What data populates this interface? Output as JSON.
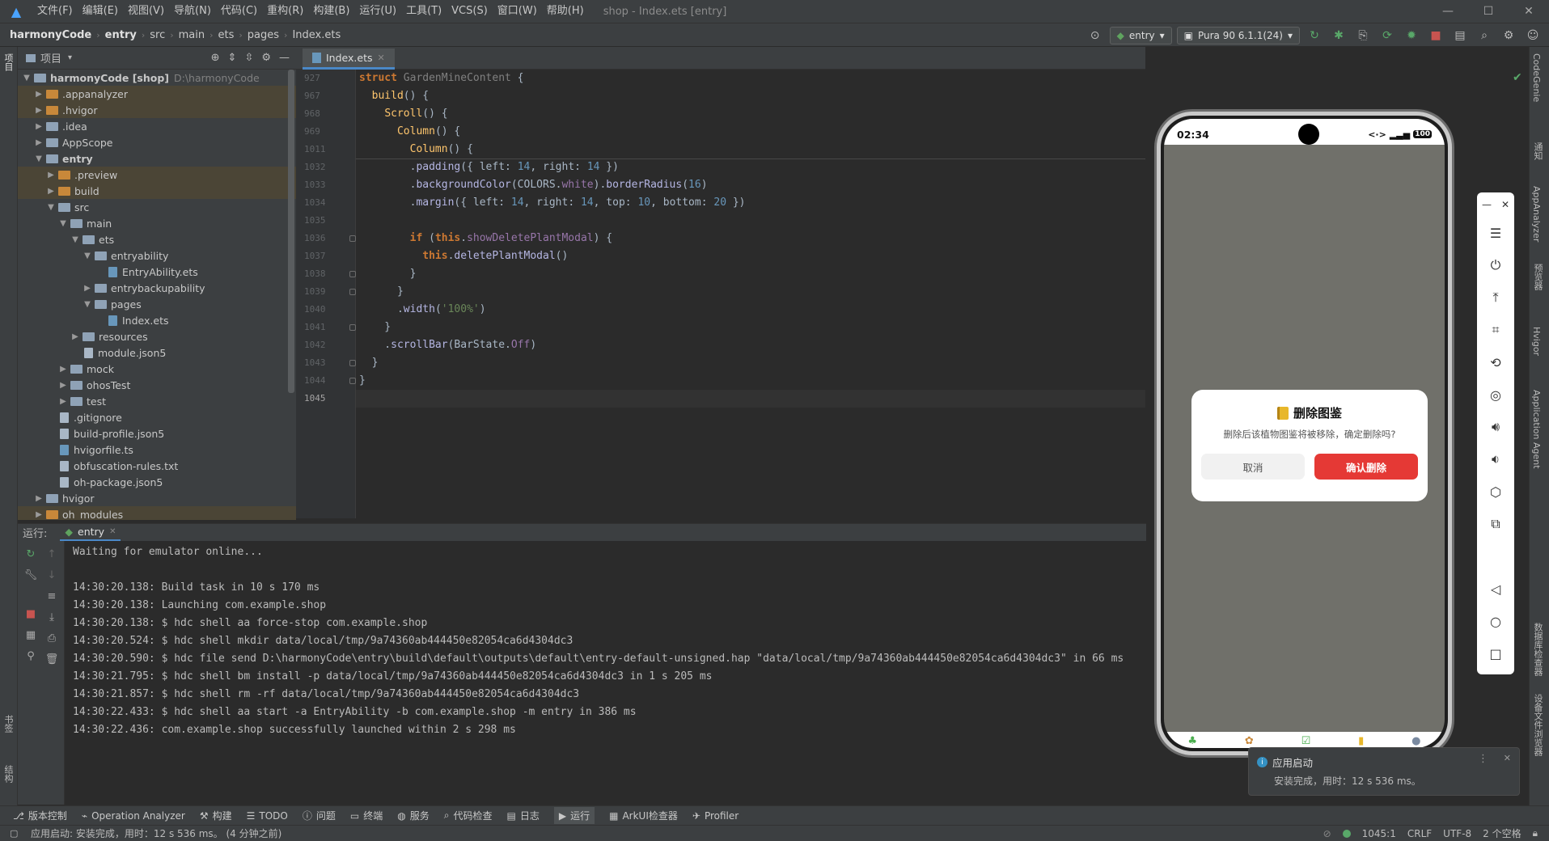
{
  "menubar": {
    "items": [
      "文件(F)",
      "编辑(E)",
      "视图(V)",
      "导航(N)",
      "代码(C)",
      "重构(R)",
      "构建(B)",
      "运行(U)",
      "工具(T)",
      "VCS(S)",
      "窗口(W)",
      "帮助(H)"
    ],
    "window_title": "shop - Index.ets [entry]"
  },
  "breadcrumb": [
    "harmonyCode",
    "entry",
    "src",
    "main",
    "ets",
    "pages",
    "Index.ets"
  ],
  "toolbar": {
    "module": "entry",
    "device": "Pura 90 6.1.1(24)"
  },
  "project_panel": {
    "title": "项目",
    "tree": [
      {
        "label": "harmonyCode [shop]",
        "path": "D:\\harmonyCode",
        "depth": 0,
        "arrow": "open",
        "icon": "folder",
        "hl": false
      },
      {
        "label": ".appanalyzer",
        "depth": 1,
        "arrow": "closed",
        "icon": "folder-orange",
        "hl": true
      },
      {
        "label": ".hvigor",
        "depth": 1,
        "arrow": "closed",
        "icon": "folder-orange",
        "hl": true
      },
      {
        "label": ".idea",
        "depth": 1,
        "arrow": "closed",
        "icon": "folder",
        "hl": false
      },
      {
        "label": "AppScope",
        "depth": 1,
        "arrow": "closed",
        "icon": "folder",
        "hl": false
      },
      {
        "label": "entry",
        "depth": 1,
        "arrow": "open",
        "icon": "folder",
        "hl": false,
        "bold": true
      },
      {
        "label": ".preview",
        "depth": 2,
        "arrow": "closed",
        "icon": "folder-orange",
        "hl": true
      },
      {
        "label": "build",
        "depth": 2,
        "arrow": "closed",
        "icon": "folder-orange",
        "hl": true
      },
      {
        "label": "src",
        "depth": 2,
        "arrow": "open",
        "icon": "folder",
        "hl": false
      },
      {
        "label": "main",
        "depth": 3,
        "arrow": "open",
        "icon": "folder",
        "hl": false
      },
      {
        "label": "ets",
        "depth": 4,
        "arrow": "open",
        "icon": "folder",
        "hl": false
      },
      {
        "label": "entryability",
        "depth": 5,
        "arrow": "open",
        "icon": "folder",
        "hl": false
      },
      {
        "label": "EntryAbility.ets",
        "depth": 6,
        "arrow": "none",
        "icon": "file-ets",
        "hl": false
      },
      {
        "label": "entrybackupability",
        "depth": 5,
        "arrow": "closed",
        "icon": "folder",
        "hl": false
      },
      {
        "label": "pages",
        "depth": 5,
        "arrow": "open",
        "icon": "folder",
        "hl": false
      },
      {
        "label": "Index.ets",
        "depth": 6,
        "arrow": "none",
        "icon": "file-ets",
        "hl": false
      },
      {
        "label": "resources",
        "depth": 4,
        "arrow": "closed",
        "icon": "folder",
        "hl": false
      },
      {
        "label": "module.json5",
        "depth": 4,
        "arrow": "none",
        "icon": "file",
        "hl": false
      },
      {
        "label": "mock",
        "depth": 3,
        "arrow": "closed",
        "icon": "folder",
        "hl": false
      },
      {
        "label": "ohosTest",
        "depth": 3,
        "arrow": "closed",
        "icon": "folder",
        "hl": false
      },
      {
        "label": "test",
        "depth": 3,
        "arrow": "closed",
        "icon": "folder",
        "hl": false
      },
      {
        "label": ".gitignore",
        "depth": 2,
        "arrow": "none",
        "icon": "file",
        "hl": false
      },
      {
        "label": "build-profile.json5",
        "depth": 2,
        "arrow": "none",
        "icon": "file",
        "hl": false
      },
      {
        "label": "hvigorfile.ts",
        "depth": 2,
        "arrow": "none",
        "icon": "file-ets",
        "hl": false
      },
      {
        "label": "obfuscation-rules.txt",
        "depth": 2,
        "arrow": "none",
        "icon": "file",
        "hl": false
      },
      {
        "label": "oh-package.json5",
        "depth": 2,
        "arrow": "none",
        "icon": "file",
        "hl": false
      },
      {
        "label": "hvigor",
        "depth": 1,
        "arrow": "closed",
        "icon": "folder",
        "hl": false
      },
      {
        "label": "oh_modules",
        "depth": 1,
        "arrow": "closed",
        "icon": "folder-orange",
        "hl": true
      }
    ]
  },
  "editor": {
    "tab": "Index.ets",
    "lines": [
      {
        "n": "927",
        "fold": false,
        "html": "<span class=\"kw\">struct</span> <span class=\"gr\">GardenMineContent</span> {"
      },
      {
        "n": "967",
        "fold": false,
        "html": "  <span class=\"fn\">build</span>() {"
      },
      {
        "n": "968",
        "fold": false,
        "html": "    <span class=\"fn\">Scroll</span>() {"
      },
      {
        "n": "969",
        "fold": false,
        "html": "      <span class=\"fn\">Column</span>() {"
      },
      {
        "n": "1011",
        "fold": false,
        "html": "        <span class=\"fn\">Column</span>() {"
      },
      {
        "n": "1032",
        "fold": false,
        "html": "        .<span class=\"ty\">padding</span>({ left: <span class=\"nu\">14</span>, right: <span class=\"nu\">14</span> })"
      },
      {
        "n": "1033",
        "fold": false,
        "html": "        .<span class=\"ty\">backgroundColor</span>(COLORS.<span class=\"pr\">white</span>).<span class=\"ty\">borderRadius</span>(<span class=\"nu\">16</span>)"
      },
      {
        "n": "1034",
        "fold": false,
        "html": "        .<span class=\"ty\">margin</span>({ left: <span class=\"nu\">14</span>, right: <span class=\"nu\">14</span>, top: <span class=\"nu\">10</span>, bottom: <span class=\"nu\">20</span> })"
      },
      {
        "n": "1035",
        "fold": false,
        "html": ""
      },
      {
        "n": "1036",
        "fold": true,
        "html": "        <span class=\"kw\">if</span> (<span class=\"kw\">this</span>.<span class=\"pr\">showDeletePlantModal</span>) {"
      },
      {
        "n": "1037",
        "fold": false,
        "html": "          <span class=\"kw\">this</span>.<span class=\"ty\">deletePlantModal</span>()"
      },
      {
        "n": "1038",
        "fold": true,
        "html": "        }"
      },
      {
        "n": "1039",
        "fold": true,
        "html": "      }"
      },
      {
        "n": "1040",
        "fold": false,
        "html": "      .<span class=\"ty\">width</span>(<span class=\"st\">'100%'</span>)"
      },
      {
        "n": "1041",
        "fold": true,
        "html": "    }"
      },
      {
        "n": "1042",
        "fold": false,
        "html": "    .<span class=\"ty\">scrollBar</span>(BarState.<span class=\"pr\">Off</span>)"
      },
      {
        "n": "1043",
        "fold": true,
        "html": "  }"
      },
      {
        "n": "1044",
        "fold": true,
        "html": "}"
      },
      {
        "n": "1045",
        "fold": false,
        "html": "",
        "cur": true
      }
    ]
  },
  "run_panel": {
    "label": "运行:",
    "tab": "entry",
    "console": [
      "Waiting for emulator online...",
      "",
      "14:30:20.138: Build task in 10 s 170 ms",
      "14:30:20.138: Launching com.example.shop",
      "14:30:20.138: $ hdc shell aa force-stop com.example.shop",
      "14:30:20.524: $ hdc shell mkdir data/local/tmp/9a74360ab444450e82054ca6d4304dc3",
      "14:30:20.590: $ hdc file send D:\\harmonyCode\\entry\\build\\default\\outputs\\default\\entry-default-unsigned.hap \"data/local/tmp/9a74360ab444450e82054ca6d4304dc3\" in 66 ms",
      "14:30:21.795: $ hdc shell bm install -p data/local/tmp/9a74360ab444450e82054ca6d4304dc3 in 1 s 205 ms",
      "14:30:21.857: $ hdc shell rm -rf data/local/tmp/9a74360ab444450e82054ca6d4304dc3",
      "14:30:22.433: $ hdc shell aa start -a EntryAbility -b com.example.shop -m entry in 386 ms",
      "14:30:22.436: com.example.shop successfully launched within 2 s 298 ms"
    ]
  },
  "bottom_tools": [
    "版本控制",
    "Operation Analyzer",
    "构建",
    "TODO",
    "问题",
    "终端",
    "服务",
    "代码检查",
    "日志",
    "运行",
    "ArkUI检查器",
    "Profiler"
  ],
  "status": {
    "message": "应用启动: 安装完成，用时：12 s 536 ms。 (4 分钟之前)",
    "position": "1045:1",
    "line_sep": "CRLF",
    "encoding": "UTF-8",
    "indent": "2 个空格"
  },
  "right_tabs": [
    "CodeGenie",
    "通知",
    "AppAnalyzer",
    "预览器",
    "Hvigor",
    "Application Agent",
    "数据库检查器",
    "设备文件浏览器"
  ],
  "left_tabs": [
    "项目",
    "书签",
    "结构"
  ],
  "phone": {
    "time": "02:34",
    "battery": "100",
    "dialog": {
      "title": "删除图鉴",
      "message": "删除后该植物图鉴将被移除，确定删除吗?",
      "cancel": "取消",
      "confirm": "确认删除"
    }
  },
  "toast": {
    "title": "应用启动",
    "body": "安装完成，用时：12 s 536 ms。"
  },
  "colors": {
    "accent": "#4a88c7",
    "danger": "#e53935",
    "keyword": "#cc7832"
  }
}
